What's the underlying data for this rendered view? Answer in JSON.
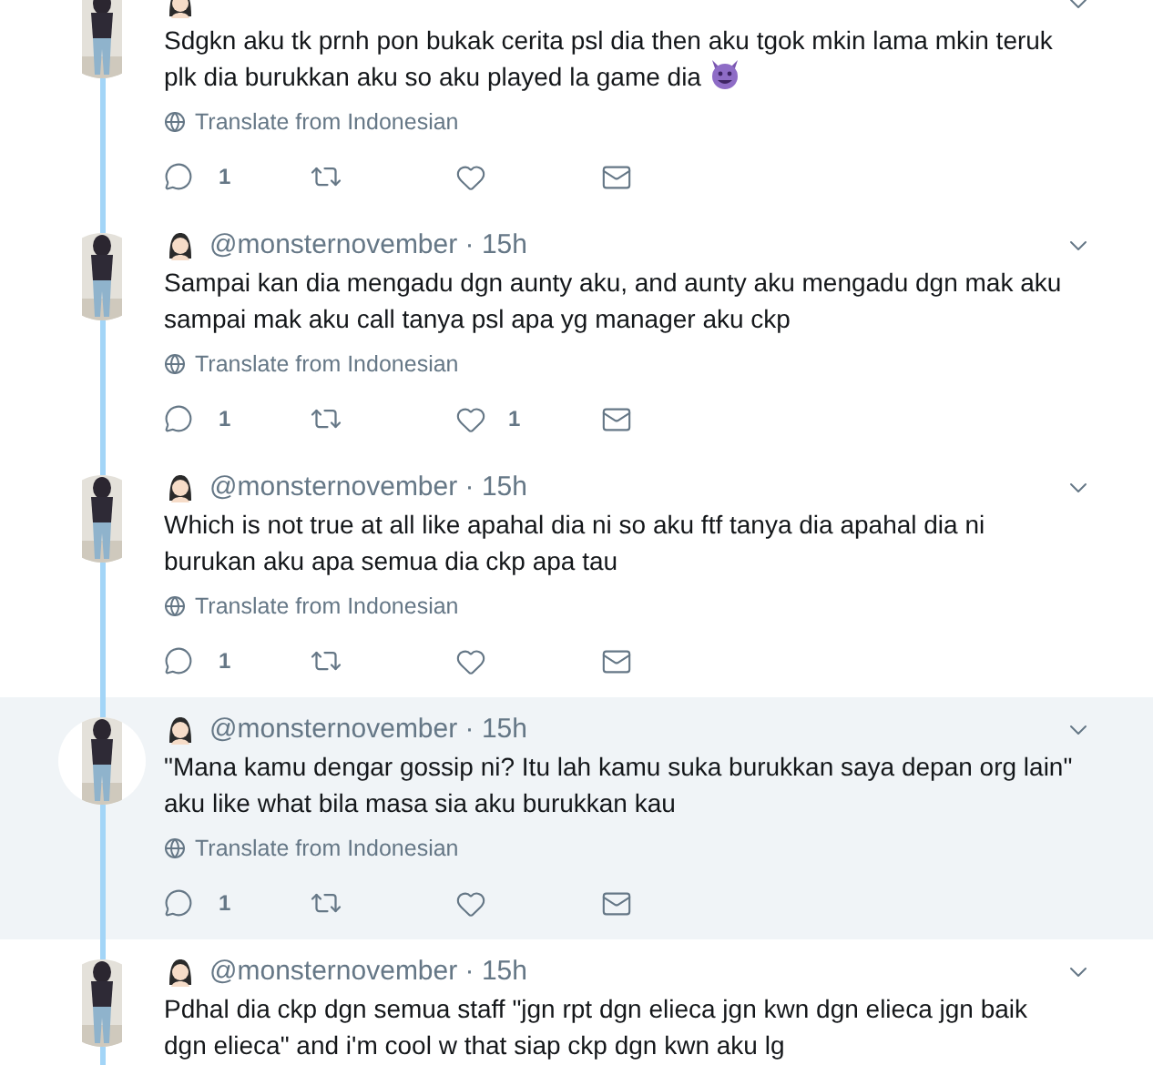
{
  "tweets": [
    {
      "text": "Sdgkn aku tk prnh pon bukak cerita psl dia then aku tgok mkin lama mkin teruk plk dia burukkan aku so aku played la game dia",
      "trailing_emoji": {
        "kind": "devil"
      },
      "translate": "Translate from Indonesian",
      "reply_count": "1",
      "highlighted": false
    },
    {
      "byline": "@monsternovember · 15h",
      "text": "Sampai kan dia mengadu dgn aunty aku, and aunty aku mengadu dgn mak aku sampai mak aku call tanya psl apa yg manager aku ckp",
      "translate": "Translate from Indonesian",
      "reply_count": "1",
      "like_count": "1",
      "highlighted": false
    },
    {
      "byline": "@monsternovember · 15h",
      "text": "Which is not true at all like apahal dia ni so aku ftf tanya dia apahal dia ni burukan aku apa semua dia ckp apa tau",
      "translate": "Translate from Indonesian",
      "reply_count": "1",
      "highlighted": false
    },
    {
      "byline": "@monsternovember · 15h",
      "text": "\"Mana kamu dengar gossip ni? Itu lah kamu suka burukkan saya depan org lain\" aku like what bila masa sia aku burukkan kau",
      "translate": "Translate from Indonesian",
      "reply_count": "1",
      "highlighted": true
    },
    {
      "byline": "@monsternovember · 15h",
      "text": "Pdhal dia ckp dgn semua staff \"jgn rpt dgn elieca jgn kwn dgn elieca jgn baik dgn elieca\" and i'm cool w that siap ckp dgn kwn aku lg",
      "highlighted": false
    }
  ]
}
